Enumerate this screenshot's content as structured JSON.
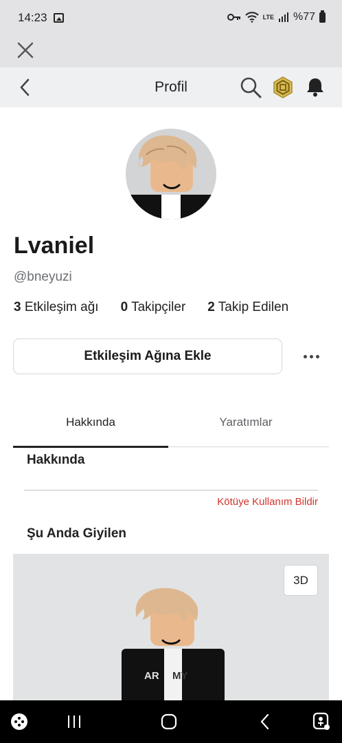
{
  "status": {
    "time": "14:23",
    "battery": "%77",
    "lte_label": "LTE"
  },
  "header": {
    "title": "Profil"
  },
  "profile": {
    "display_name": "Lvaniel",
    "username": "@bneyuzi",
    "stats": [
      {
        "count": "3",
        "label": "Etkileşim ağı"
      },
      {
        "count": "0",
        "label": "Takipçiler"
      },
      {
        "count": "2",
        "label": "Takip Edilen"
      }
    ],
    "add_button_label": "Etkileşim Ağına Ekle"
  },
  "tabs": [
    {
      "label": "Hakkında"
    },
    {
      "label": "Yaratımlar"
    }
  ],
  "about": {
    "heading": "Hakkında",
    "report_label": "Kötüye Kullanım Bildir",
    "wearing_heading": "Şu Anda Giyilen"
  },
  "preview": {
    "mode_label": "3D",
    "shirt_text": "ARMY"
  },
  "colors": {
    "accent_red": "#d0342c",
    "header_bg": "#eef0f2",
    "status_bg": "#e3e3e5",
    "coin": "#c7a43b"
  },
  "icons": [
    "image-icon",
    "key-icon",
    "wifi-icon",
    "signal-icon",
    "battery-icon",
    "close-icon",
    "back-chevron-icon",
    "search-icon",
    "currency-icon",
    "bell-icon",
    "more-icon",
    "game-launcher-icon",
    "recent-apps-icon",
    "home-icon",
    "nav-back-icon",
    "accessibility-icon"
  ]
}
